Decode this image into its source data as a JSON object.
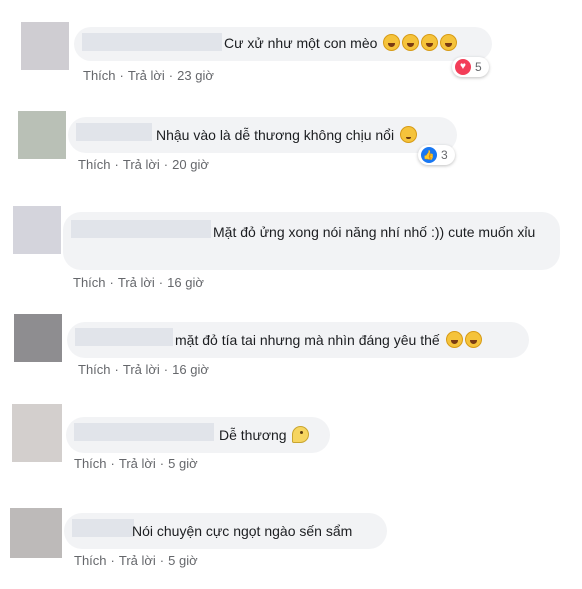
{
  "actions": {
    "like": "Thích",
    "reply": "Trả lời",
    "dot": "·"
  },
  "comments": [
    {
      "text": "Cư xử như một con mèo",
      "time": "23 giờ",
      "reaction_count": "5",
      "reaction_icon": "heart-icon",
      "emoji_count": 4
    },
    {
      "text": "Nhậu vào là dễ thương không chịu nổi",
      "time": "20 giờ",
      "reaction_count": "3",
      "reaction_icon": "like-icon",
      "emoji_count": 1
    },
    {
      "text": "Mặt đỏ ửng xong nói năng nhí nhố :)) cute muốn xỉu",
      "time": "16 giờ"
    },
    {
      "text": "mặt đỏ tía tai nhưng mà nhìn đáng yêu thế",
      "time": "16 giờ",
      "emoji_count": 2
    },
    {
      "text": "Dễ thương",
      "time": "5 giờ",
      "emoji_count": 1
    },
    {
      "text": "Nói chuyện cực ngọt ngào sến sẩm",
      "time": "5 giờ"
    }
  ],
  "colors": {
    "avatars": [
      "#cfcdd2",
      "#b9c0b6",
      "#d4d4dc",
      "#8e8d90",
      "#d3cfcd",
      "#bdbab9"
    ],
    "heart": "#f33e58",
    "like": "#1877f2"
  }
}
